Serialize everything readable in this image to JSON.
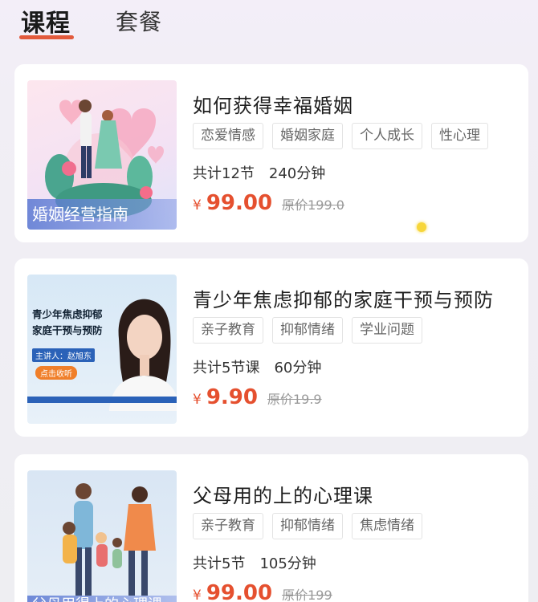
{
  "tabs": [
    {
      "label": "课程",
      "active": true
    },
    {
      "label": "套餐",
      "active": false
    }
  ],
  "colors": {
    "accent": "#e25a3c",
    "price": "#e5502f"
  },
  "courses": [
    {
      "title": "如何获得幸福婚姻",
      "tags": [
        "恋爱情感",
        "婚姻家庭",
        "个人成长",
        "性心理"
      ],
      "lessons": "共计12节",
      "duration": "240分钟",
      "currency": "¥",
      "price": "99.00",
      "original_price": "原价199.0",
      "thumb_caption": "婚姻经营指南"
    },
    {
      "title": "青少年焦虑抑郁的家庭干预与预防",
      "tags": [
        "亲子教育",
        "抑郁情绪",
        "学业问题"
      ],
      "lessons": "共计5节课",
      "duration": "60分钟",
      "currency": "¥",
      "price": "9.90",
      "original_price": "原价19.9",
      "thumb_title": "青少年焦虑抑郁\n家庭干预与预防",
      "thumb_speaker": "主讲人：赵旭东",
      "thumb_button": "点击收听"
    },
    {
      "title": "父母用的上的心理课",
      "tags": [
        "亲子教育",
        "抑郁情绪",
        "焦虑情绪"
      ],
      "lessons": "共计5节",
      "duration": "105分钟",
      "currency": "¥",
      "price": "99.00",
      "original_price": "原价199",
      "thumb_caption": "父母用得上的心理课"
    }
  ]
}
